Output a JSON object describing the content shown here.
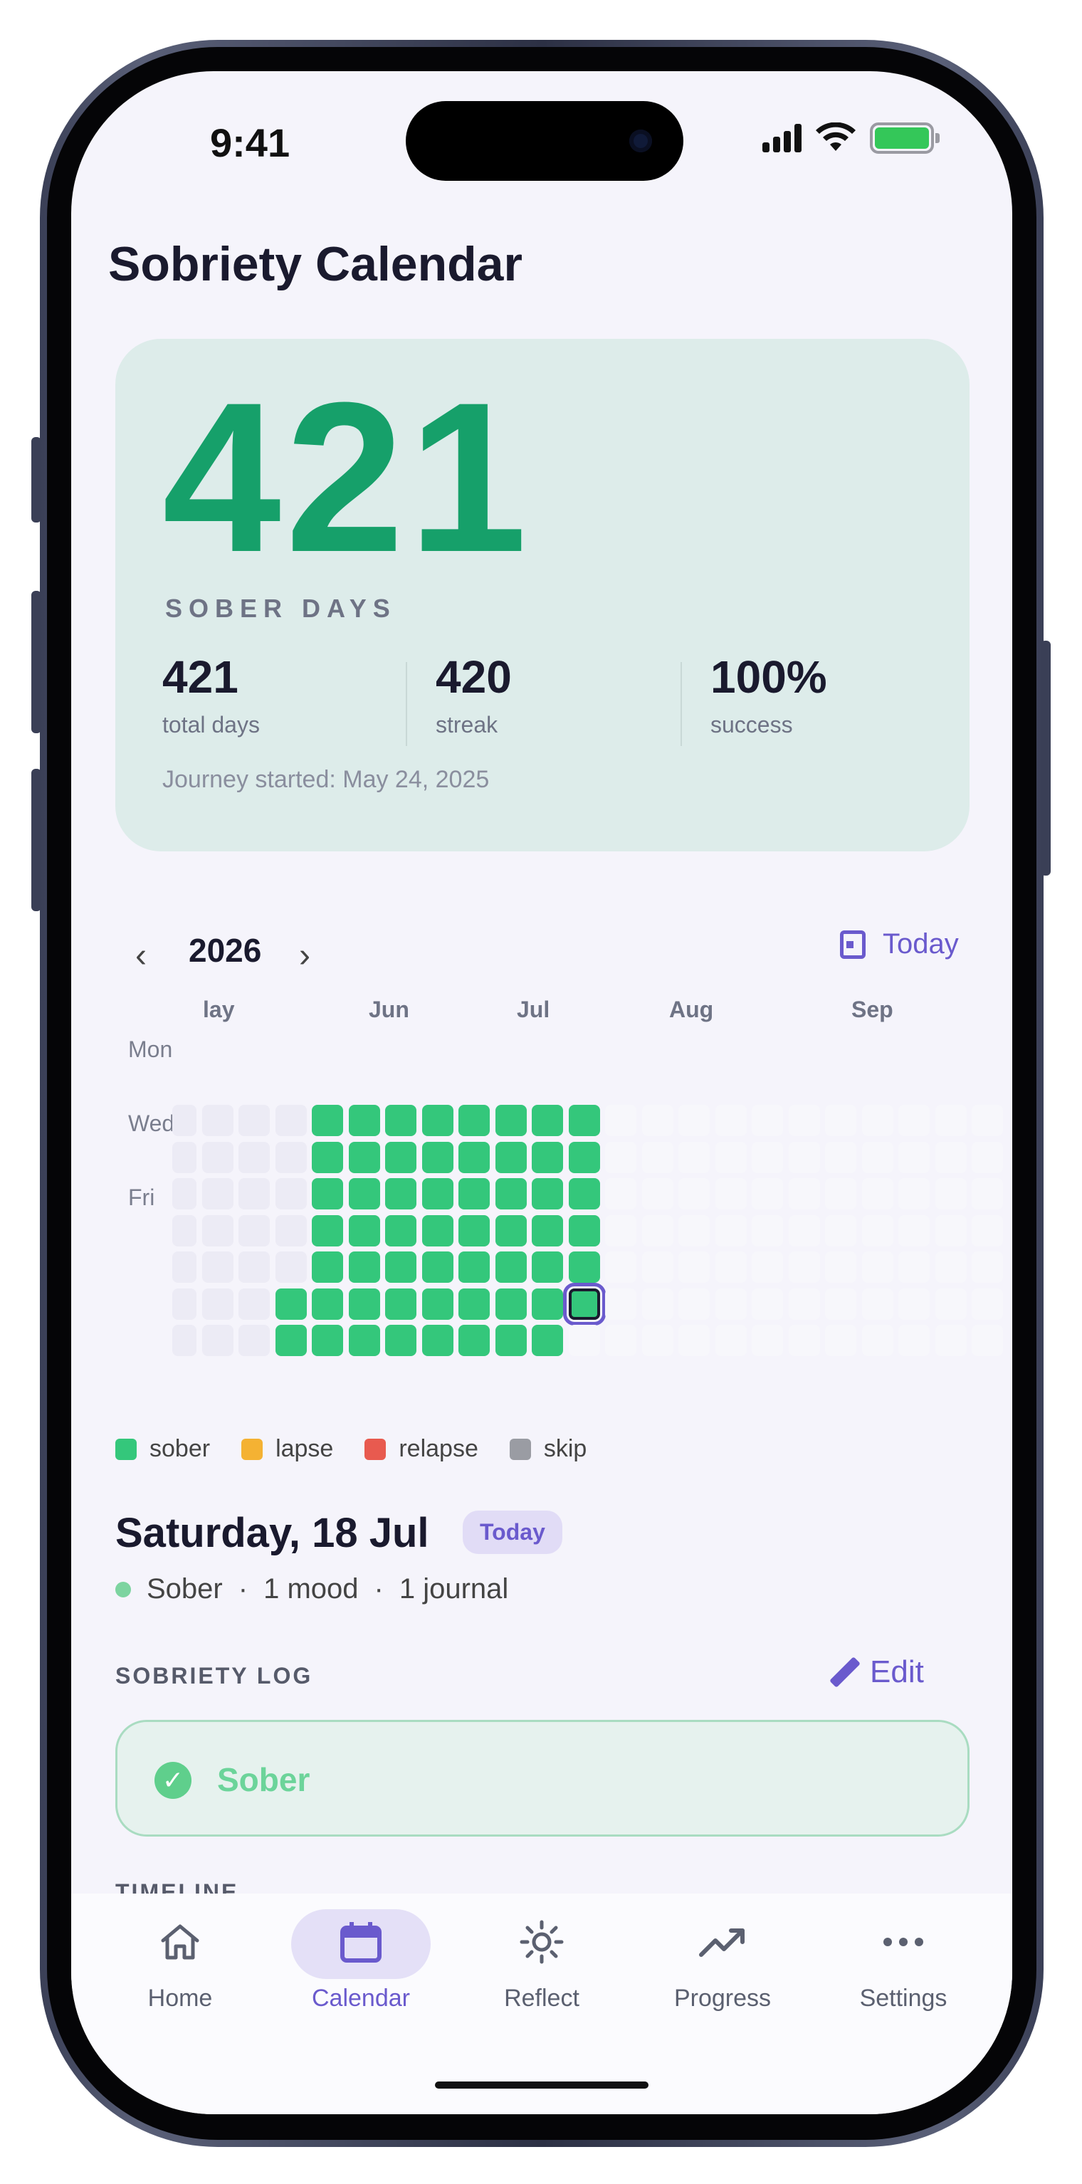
{
  "status_bar": {
    "time": "9:41"
  },
  "page": {
    "title": "Sobriety Calendar"
  },
  "summary": {
    "sober_days": "421",
    "sober_days_label": "SOBER DAYS",
    "stats": [
      {
        "value": "421",
        "label": "total days"
      },
      {
        "value": "420",
        "label": "streak"
      },
      {
        "value": "100%",
        "label": "success"
      }
    ],
    "journey_started": "Journey started: May 24, 2025"
  },
  "calendar": {
    "year": "2026",
    "prev_icon": "chevron-left-icon",
    "next_icon": "chevron-right-icon",
    "today_label": "Today",
    "months": [
      "lay",
      "Jun",
      "Jul",
      "Aug",
      "Sep"
    ],
    "weekday_labels": [
      "Mon",
      "Wed",
      "Fri"
    ],
    "selected_date": "2026-07-18"
  },
  "legend": [
    {
      "label": "sober",
      "color": "#34c77b"
    },
    {
      "label": "lapse",
      "color": "#f4b233"
    },
    {
      "label": "relapse",
      "color": "#e85a4f"
    },
    {
      "label": "skip",
      "color": "#9a9ca3"
    }
  ],
  "day_detail": {
    "title": "Saturday, 18 Jul",
    "badge": "Today",
    "status": "Sober",
    "sep": "·",
    "mood": "1 mood",
    "journal": "1 journal",
    "sobriety_log_label": "SOBRIETY LOG",
    "edit_label": "Edit",
    "log_status": "Sober",
    "timeline_label": "TIMELINE"
  },
  "colors": {
    "accent": "#6a5acd",
    "sober": "#34c77b",
    "hero_number": "#16a06a",
    "empty_past": "#ecebf5",
    "empty_future": "#f7f7fb"
  },
  "nav": [
    {
      "label": "Home",
      "icon": "home-icon",
      "active": false
    },
    {
      "label": "Calendar",
      "icon": "calendar-icon",
      "active": true
    },
    {
      "label": "Reflect",
      "icon": "sun-icon",
      "active": false
    },
    {
      "label": "Progress",
      "icon": "trending-up-icon",
      "active": false
    },
    {
      "label": "Settings",
      "icon": "more-horizontal-icon",
      "active": false
    }
  ]
}
